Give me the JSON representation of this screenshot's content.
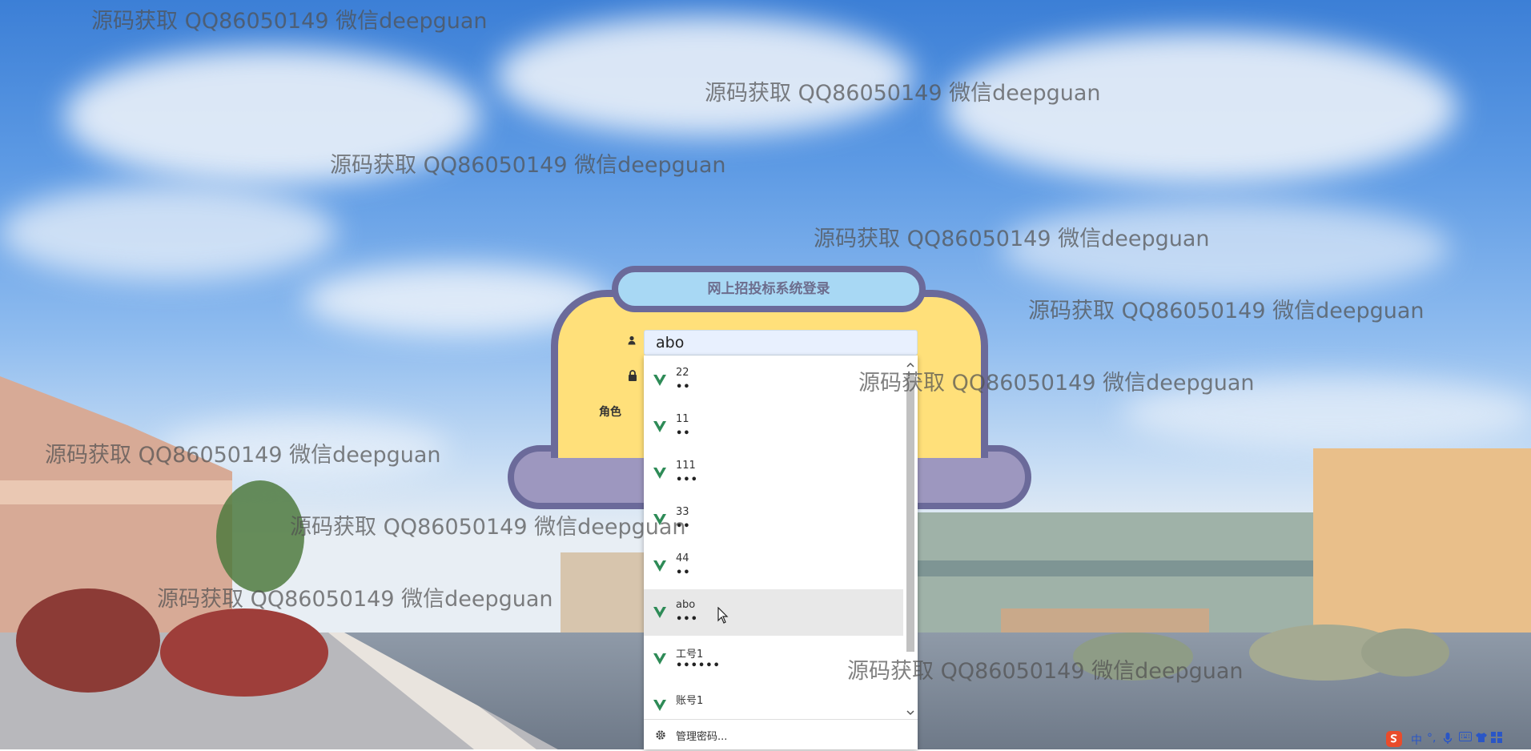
{
  "login": {
    "title": "网上招投标系统登录",
    "username_value": "abo",
    "role_label": "角色"
  },
  "autocomplete": {
    "items": [
      {
        "user": "22",
        "password_mask": "••"
      },
      {
        "user": "11",
        "password_mask": "••"
      },
      {
        "user": "111",
        "password_mask": "•••"
      },
      {
        "user": "33",
        "password_mask": "••"
      },
      {
        "user": "44",
        "password_mask": "••"
      },
      {
        "user": "abo",
        "password_mask": "•••"
      },
      {
        "user": "工号1",
        "password_mask": "••••••"
      },
      {
        "user": "账号1",
        "password_mask": ""
      }
    ],
    "active_index": 5,
    "manage_passwords_label": "管理密码..."
  },
  "watermark": {
    "text": "源码获取 QQ86050149 微信deepguan"
  },
  "tray": {
    "ime_mode": "中"
  },
  "colors": {
    "card_fill": "#ffe07a",
    "card_border": "#6b6a9a",
    "title_fill": "#a8d8f4",
    "base_fill": "#9d97bf",
    "entry_icon": "#2e8b57"
  }
}
